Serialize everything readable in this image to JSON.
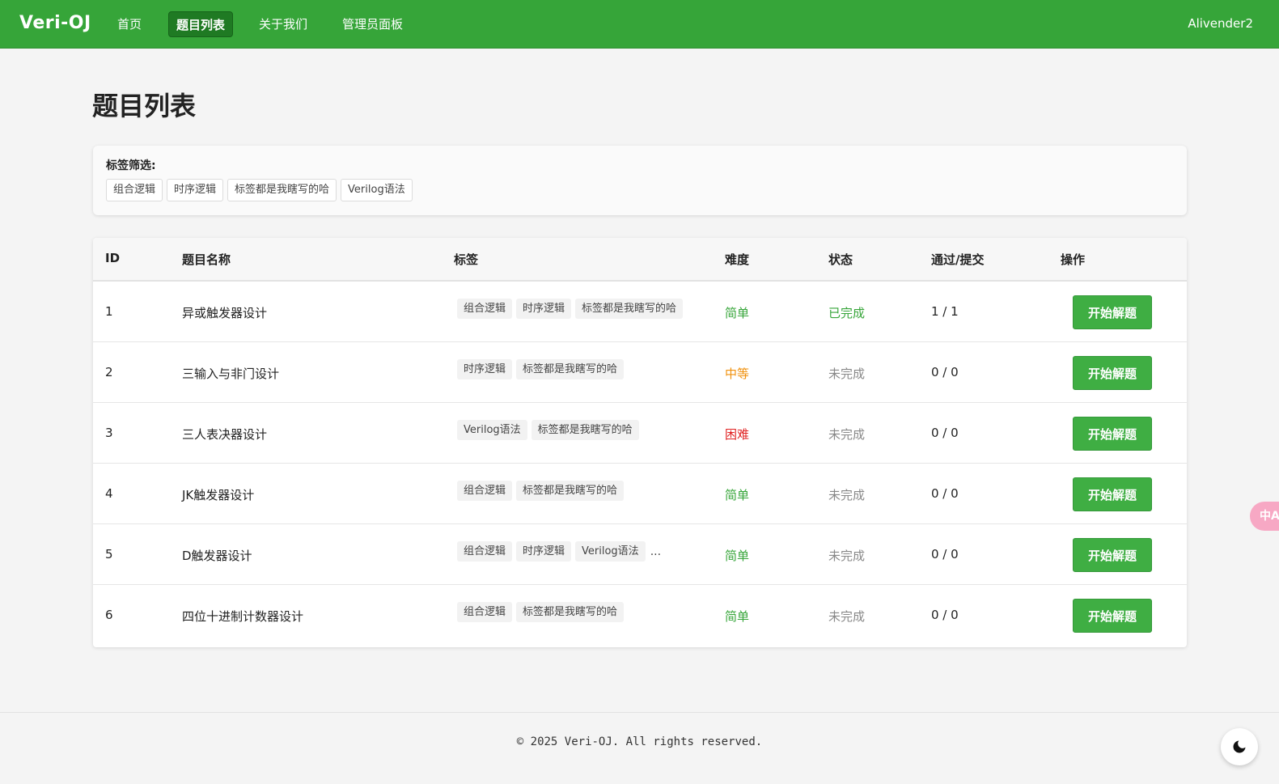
{
  "navbar": {
    "brand": "Veri-OJ",
    "items": [
      {
        "label": "首页"
      },
      {
        "label": "题目列表"
      },
      {
        "label": "关于我们"
      },
      {
        "label": "管理员面板"
      }
    ],
    "active_item": "题目列表",
    "user": "Alivender2",
    "background": "#36a539"
  },
  "page": {
    "title": "题目列表"
  },
  "filter": {
    "label": "标签筛选:",
    "tags": [
      "组合逻辑",
      "时序逻辑",
      "标签都是我瞎写的哈",
      "Verilog语法"
    ]
  },
  "table": {
    "headers": {
      "id": "ID",
      "name": "题目名称",
      "tags": "标签",
      "difficulty": "难度",
      "status": "状态",
      "ratio": "通过/提交",
      "action": "操作"
    },
    "rows": [
      {
        "id": "1",
        "name": "异或触发器设计",
        "tags": [
          "组合逻辑",
          "时序逻辑",
          "标签都是我瞎写的哈"
        ],
        "more": "",
        "difficulty": "简单",
        "status": "已完成",
        "ratio": "1 / 1",
        "action": "开始解题"
      },
      {
        "id": "2",
        "name": "三输入与非门设计",
        "tags": [
          "时序逻辑",
          "标签都是我瞎写的哈"
        ],
        "more": "",
        "difficulty": "中等",
        "status": "未完成",
        "ratio": "0 / 0",
        "action": "开始解题"
      },
      {
        "id": "3",
        "name": "三人表决器设计",
        "tags": [
          "Verilog语法",
          "标签都是我瞎写的哈"
        ],
        "more": "",
        "difficulty": "困难",
        "status": "未完成",
        "ratio": "0 / 0",
        "action": "开始解题"
      },
      {
        "id": "4",
        "name": "JK触发器设计",
        "tags": [
          "组合逻辑",
          "标签都是我瞎写的哈"
        ],
        "more": "",
        "difficulty": "简单",
        "status": "未完成",
        "ratio": "0 / 0",
        "action": "开始解题"
      },
      {
        "id": "5",
        "name": "D触发器设计",
        "tags": [
          "组合逻辑",
          "时序逻辑",
          "Verilog语法"
        ],
        "more": "...",
        "difficulty": "简单",
        "status": "未完成",
        "ratio": "0 / 0",
        "action": "开始解题"
      },
      {
        "id": "6",
        "name": "四位十进制计数器设计",
        "tags": [
          "组合逻辑",
          "标签都是我瞎写的哈"
        ],
        "more": "",
        "difficulty": "简单",
        "status": "未完成",
        "ratio": "0 / 0",
        "action": "开始解题"
      }
    ]
  },
  "colors": {
    "easy": "#36a539",
    "medium": "#f0900c",
    "hard": "#e02020",
    "done": "#36a539",
    "todo": "#888888",
    "button": "#3fae43"
  },
  "footer": {
    "text": "© 2025 Veri-OJ. All rights reserved."
  },
  "floating": {
    "translate_label": "中A",
    "translate_icon": "translate-icon",
    "theme_icon": "moon-icon"
  }
}
